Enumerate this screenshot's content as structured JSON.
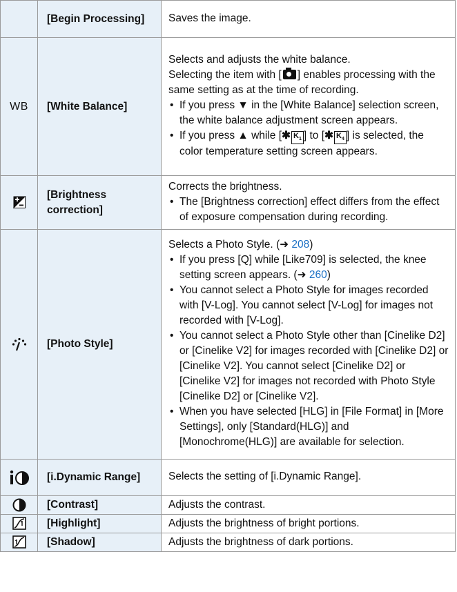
{
  "rows": [
    {
      "name": "[Begin Processing]",
      "icon": "",
      "desc_intro": [
        "Saves the image."
      ],
      "bullets": []
    },
    {
      "name": "[White Balance]",
      "icon": "wb-icon",
      "icon_text": "WB",
      "desc_intro": [
        "Selects and adjusts the white balance."
      ],
      "camera_line": {
        "before": "Selecting the item with [",
        "after": "] enables processing with the same setting as at the time of recording."
      },
      "bullets": [
        "If you press ▼ in the [White Balance] selection screen, the white balance adjustment screen appears."
      ],
      "kelvin_bullet": {
        "a": "If you press ▲ while [",
        "b": "] to [",
        "c": "] is selected, the color temperature setting screen appears.",
        "k1": "K",
        "k1_sub": "1",
        "k4": "K",
        "k4_sub": "4"
      }
    },
    {
      "name": "[Brightness correction]",
      "icon": "brightness-correction-icon",
      "desc_intro": [
        "Corrects the brightness."
      ],
      "bullets": [
        "The [Brightness correction] effect differs from the effect of exposure compensation during recording."
      ]
    },
    {
      "name": "[Photo Style]",
      "icon": "photo-style-icon",
      "photo_intro": {
        "text": "Selects a Photo Style. (➜ ",
        "page": "208",
        "close": ")"
      },
      "photo_b1": {
        "text": "If you press [Q] while [Like709] is selected, the knee setting screen appears. (➜ ",
        "page": "260",
        "close": ")"
      },
      "bullets": [
        "You cannot select a Photo Style for images recorded with [V-Log]. You cannot select [V-Log] for images not recorded with [V-Log].",
        "You cannot select a Photo Style other than [Cinelike D2] or [Cinelike V2] for images recorded with [Cinelike D2] or [Cinelike V2]. You cannot select [Cinelike D2] or [Cinelike V2] for images not recorded with Photo Style [Cinelike D2] or [Cinelike V2].",
        "When you have selected [HLG] in [File Format] in [More Settings], only [Standard(HLG)] and [Monochrome(HLG)] are available for selection."
      ]
    },
    {
      "name": "[i.Dynamic Range]",
      "icon": "i-dynamic-range-icon",
      "desc_intro": [
        "Selects the setting of [i.Dynamic Range]."
      ],
      "bullets": []
    },
    {
      "name": "[Contrast]",
      "icon": "contrast-icon",
      "desc_intro": [
        "Adjusts the contrast."
      ],
      "bullets": []
    },
    {
      "name": "[Highlight]",
      "icon": "highlight-icon",
      "desc_intro": [
        "Adjusts the brightness of bright portions."
      ],
      "bullets": []
    },
    {
      "name": "[Shadow]",
      "icon": "shadow-icon",
      "desc_intro": [
        "Adjusts the brightness of dark portions."
      ],
      "bullets": []
    }
  ]
}
